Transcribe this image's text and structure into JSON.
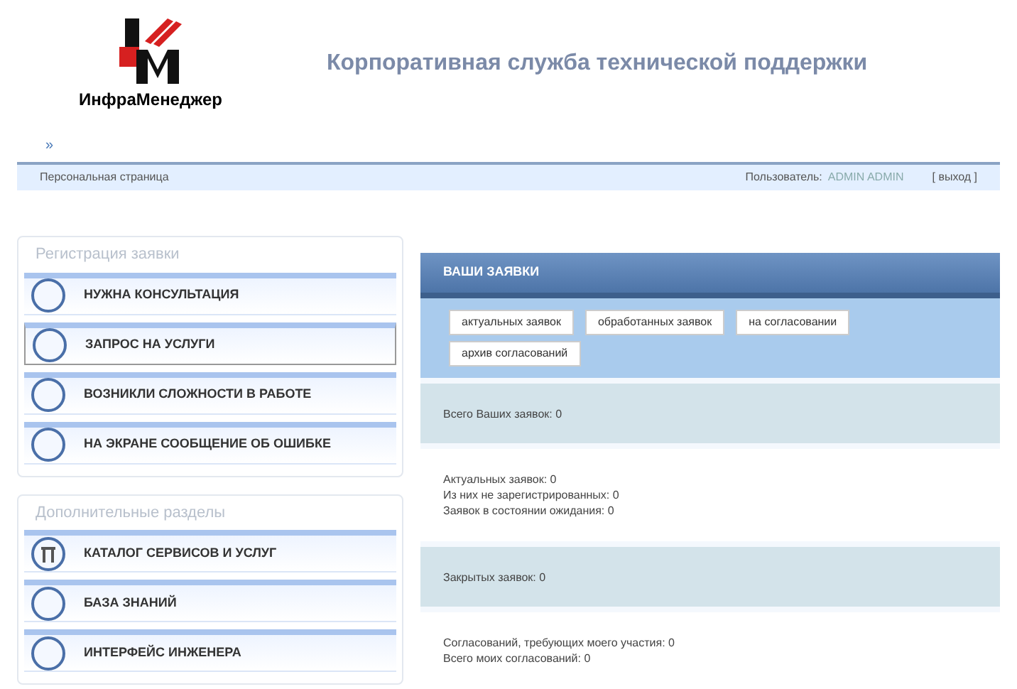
{
  "header": {
    "brand": "ИнфраМенеджер",
    "title": "Корпоративная служба технической поддержки"
  },
  "nav": {
    "breadcrumb": "»"
  },
  "userbar": {
    "page": "Персональная страница",
    "user_label": "Пользователь:",
    "user": "ADMIN ADMIN",
    "logout": "[ выход ]"
  },
  "sidebar": [
    {
      "legend": "Регистрация заявки",
      "items": [
        {
          "label": "НУЖНА КОНСУЛЬТАЦИЯ",
          "kind": "plain",
          "selected": false
        },
        {
          "label": "ЗАПРОС НА УСЛУГИ",
          "kind": "plain",
          "selected": true
        },
        {
          "label": "ВОЗНИКЛИ СЛОЖНОСТИ В РАБОТЕ",
          "kind": "plain",
          "selected": false
        },
        {
          "label": "НА ЭКРАНЕ СООБЩЕНИЕ ОБ ОШИБКЕ",
          "kind": "plain",
          "selected": false
        }
      ]
    },
    {
      "legend": "Дополнительные разделы",
      "items": [
        {
          "label": "КАТАЛОГ СЕРВИСОВ И УСЛУГ",
          "kind": "catalog",
          "selected": false
        },
        {
          "label": "БАЗА ЗНАНИЙ",
          "kind": "plain",
          "selected": false
        },
        {
          "label": "ИНТЕРФЕЙС ИНЖЕНЕРА",
          "kind": "plain",
          "selected": false
        }
      ]
    }
  ],
  "panel": {
    "title": "ВАШИ ЗАЯВКИ",
    "filters": [
      "актуальных заявок",
      "обработанных заявок",
      "на согласовании",
      "архив согласований"
    ],
    "sections": [
      {
        "kind": "band",
        "lines": [
          "Всего Ваших заявок: 0"
        ]
      },
      {
        "kind": "plain",
        "lines": [
          "Актуальных заявок: 0",
          "Из них не зарегистрированных: 0",
          "Заявок в состоянии ожидания: 0"
        ]
      },
      {
        "kind": "band",
        "lines": [
          "Закрытых заявок: 0"
        ]
      },
      {
        "kind": "plain",
        "lines": [
          "Согласований, требующих моего участия: 0",
          "Всего моих согласований: 0"
        ]
      }
    ]
  }
}
